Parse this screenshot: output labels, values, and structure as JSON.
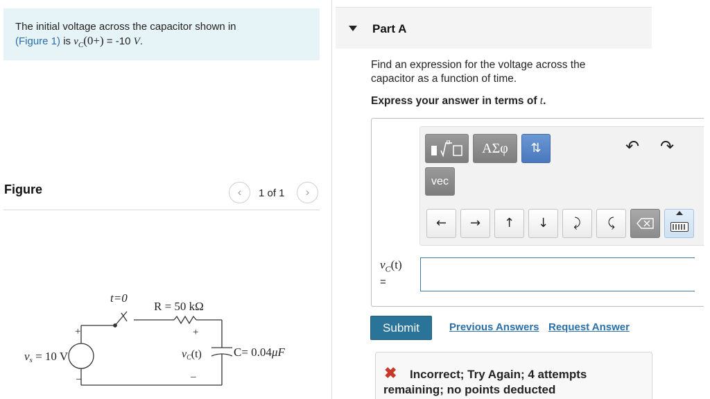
{
  "intro": {
    "text_before": "The initial voltage across the capacitor shown in",
    "figure_link": "(Figure 1)",
    "text_is": " is ",
    "vc_symbol": "v",
    "vc_sub": "C",
    "vc_arg": "(0+)",
    "equals_value": " = -10 ",
    "unit": "V",
    "period": "."
  },
  "figure": {
    "title": "Figure",
    "pagination": "1 of 1",
    "prev_icon": "chevron-left-icon",
    "next_icon": "chevron-right-icon",
    "circuit": {
      "switch_label": "t=0",
      "resistor_label": "R = 50 kΩ",
      "source_label": "v",
      "source_sub": "s",
      "source_value": " = 10 V",
      "cap_voltage": "v",
      "cap_voltage_sub": "C",
      "cap_voltage_arg": "(t)",
      "cap_label": "C= 0.04",
      "cap_unit": "μF",
      "plus": "+",
      "minus": "–"
    }
  },
  "part": {
    "title": "Part A",
    "question": "Find an expression for the voltage across the capacitor as a function of time.",
    "express_prefix": "Express your answer in terms of ",
    "express_var": "t",
    "express_suffix": "."
  },
  "toolbar": {
    "templates_icon": "fraction-sqrt-template-icon",
    "greek_label": "ΑΣφ",
    "arrows_label": "⇅",
    "vec_label": "vec",
    "undo_icon": "undo-icon",
    "redo_icon": "redo-icon",
    "nav": {
      "left": "←",
      "right": "→",
      "up": "↑",
      "down": "↓",
      "enter": "⤸",
      "back": "⤹",
      "delete_icon": "backspace-icon",
      "keyboard_icon": "keyboard-icon"
    }
  },
  "answer": {
    "var": "v",
    "var_sub": "C",
    "var_arg": "(t)",
    "equals": "=",
    "value": ""
  },
  "actions": {
    "submit": "Submit",
    "previous_answers": "Previous Answers",
    "request_answer": "Request Answer"
  },
  "feedback": {
    "icon": "x-icon",
    "text": "Incorrect; Try Again; 4 attempts remaining; no points deducted",
    "color": "#c73a2b"
  },
  "colors": {
    "intro_bg": "#e6f3f7",
    "link": "#2a6fa8",
    "submit_bg": "#2a7399",
    "accent_button": "#4a78bd"
  }
}
